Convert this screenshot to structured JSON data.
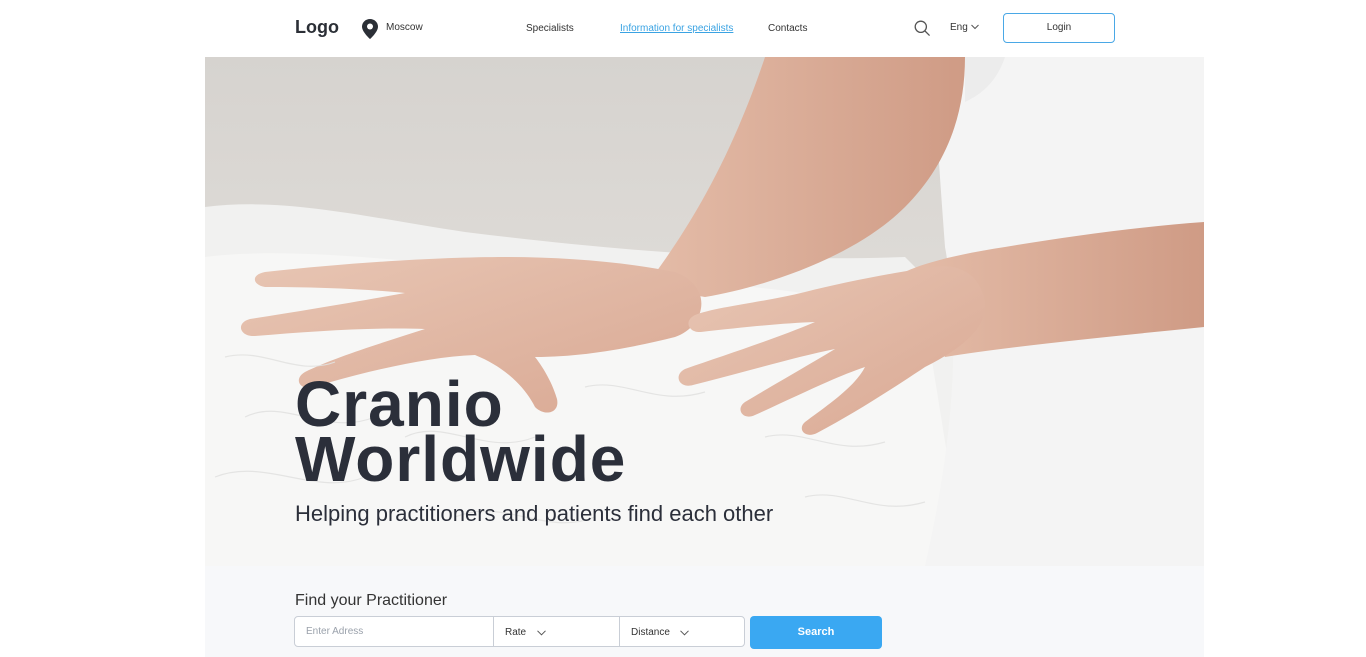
{
  "header": {
    "logo": "Logo",
    "city": "Moscow",
    "nav": {
      "specialists": "Specialists",
      "info": "Information for specialists",
      "contacts": "Contacts"
    },
    "language": "Eng",
    "login_label": "Login"
  },
  "hero": {
    "title_line1": "Cranio",
    "title_line2": "Worldwide",
    "subtitle": "Helping practitioners and patients find each other"
  },
  "finder": {
    "title": "Find your Practitioner",
    "address_placeholder": "Enter Adress",
    "rate_label": "Rate",
    "distance_label": "Distance",
    "search_label": "Search"
  },
  "colors": {
    "accent": "#3aa8f2",
    "link": "#3aa3e3",
    "text_dark": "#2b2f3a"
  },
  "icons": [
    "location-pin-icon",
    "search-icon",
    "chevron-down-icon"
  ]
}
